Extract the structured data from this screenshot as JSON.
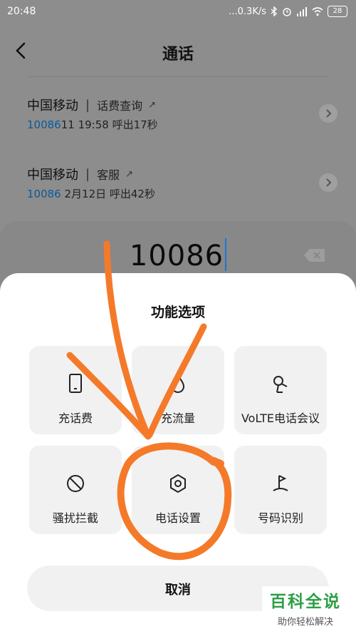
{
  "status_bar": {
    "time": "20:48",
    "net_speed": "...0.3K/s",
    "battery": "28"
  },
  "nav": {
    "title": "通话"
  },
  "calls": [
    {
      "carrier": "中国移动",
      "tag": "话费查询",
      "number": "10086",
      "suffix": "11 19:58 呼出17秒"
    },
    {
      "carrier": "中国移动",
      "tag": "客服",
      "number": "10086",
      "suffix": " 2月12日 呼出42秒"
    }
  ],
  "dialer": {
    "number": "10086"
  },
  "sheet": {
    "title": "功能选项",
    "options": [
      {
        "label": "充话费",
        "icon": "phone-icon"
      },
      {
        "label": "充流量",
        "icon": "droplet-icon"
      },
      {
        "label": "VoLTE电话会议",
        "icon": "satellite-dish-icon"
      },
      {
        "label": "骚扰拦截",
        "icon": "block-icon"
      },
      {
        "label": "电话设置",
        "icon": "gear-icon"
      },
      {
        "label": "号码识别",
        "icon": "flag-icon"
      }
    ],
    "cancel_label": "取消"
  },
  "annotation": {
    "color": "#f47a2a"
  },
  "watermark": {
    "brand": "百科全说",
    "slogan": "助你轻松解决",
    "color": "#2c9f45"
  }
}
